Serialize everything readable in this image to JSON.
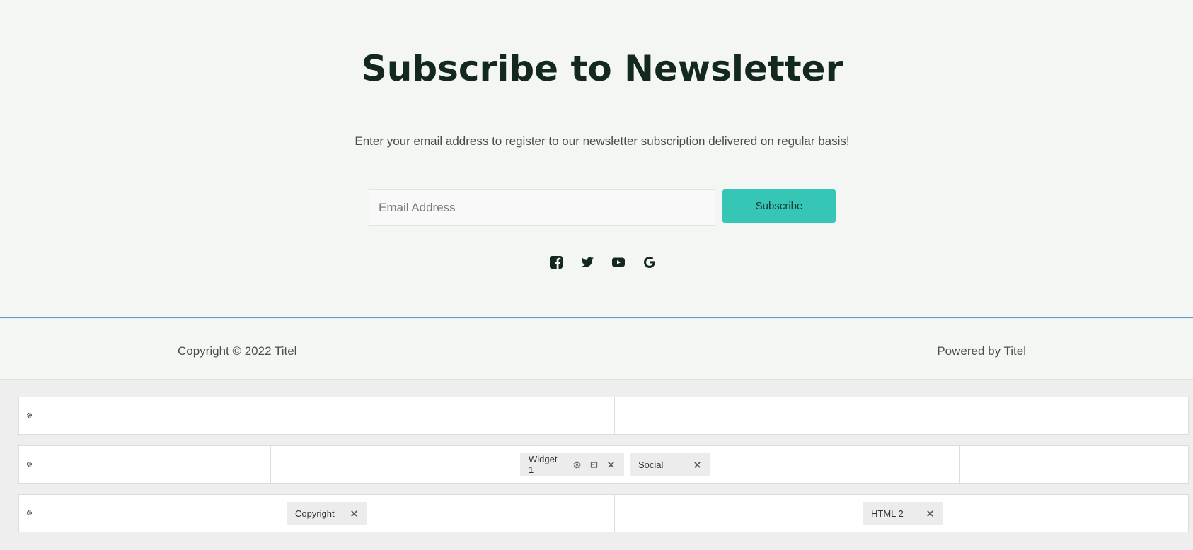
{
  "newsletter": {
    "title": "Subscribe to Newsletter",
    "description": "Enter your email address to register to our newsletter subscription delivered on regular basis!",
    "email_placeholder": "Email Address",
    "subscribe_label": "Subscribe",
    "social_icons": [
      "facebook-icon",
      "twitter-icon",
      "youtube-icon",
      "google-icon"
    ]
  },
  "footer": {
    "copyright": "Copyright © 2022 Titel",
    "powered_by": "Powered by Titel"
  },
  "builder": {
    "rows": [
      {
        "widgets": []
      },
      {
        "widgets": [
          {
            "label": "Widget 1"
          },
          {
            "label": "Social"
          }
        ]
      },
      {
        "widgets": [
          {
            "label": "Copyright"
          },
          {
            "label": "HTML 2"
          }
        ]
      }
    ]
  },
  "colors": {
    "accent": "#35c6b5",
    "title": "#13291f",
    "divider": "#5a9bc9",
    "edit_tab": "#9ec3e4"
  }
}
